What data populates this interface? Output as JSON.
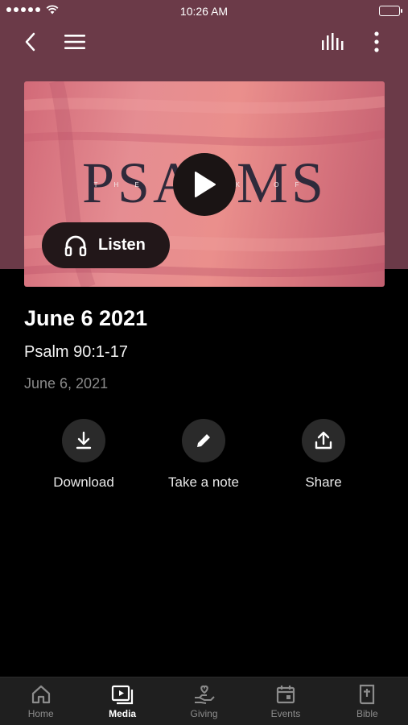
{
  "status_bar": {
    "time": "10:26 AM"
  },
  "nav": {
    "back_icon": "chevron-left-icon",
    "menu_icon": "hamburger-icon",
    "audio_icon": "equalizer-icon",
    "more_icon": "more-vertical-icon"
  },
  "hero": {
    "title_art": "PSALMS",
    "subtitle_art": "THE BOOK OF",
    "listen_label": "Listen",
    "colors": {
      "header": "#6b3a48",
      "hero_pink": "#e58d92"
    }
  },
  "sermon": {
    "title": "June 6 2021",
    "passage": "Psalm 90:1-17",
    "date": "June 6, 2021"
  },
  "actions": [
    {
      "label": "Download",
      "icon": "download-icon"
    },
    {
      "label": "Take a note",
      "icon": "pencil-icon"
    },
    {
      "label": "Share",
      "icon": "share-icon"
    }
  ],
  "tabs": [
    {
      "label": "Home",
      "icon": "home-icon",
      "active": false
    },
    {
      "label": "Media",
      "icon": "media-icon",
      "active": true
    },
    {
      "label": "Giving",
      "icon": "giving-icon",
      "active": false
    },
    {
      "label": "Events",
      "icon": "calendar-icon",
      "active": false
    },
    {
      "label": "Bible",
      "icon": "bible-icon",
      "active": false
    }
  ]
}
